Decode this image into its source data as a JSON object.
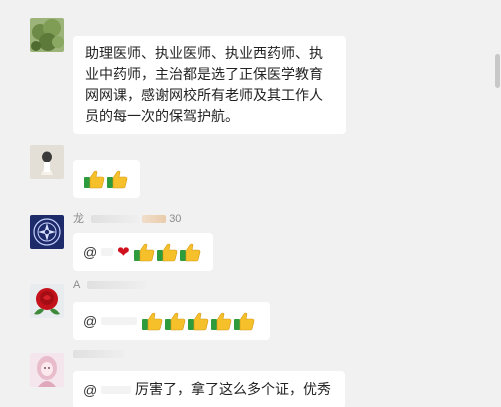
{
  "messages": [
    {
      "sender": "",
      "text": "助理医师、执业医师、执业西药师、执业中药师，主治都是选了正保医学教育网网课，感谢网校所有老师及其工作人员的每一次的保驾护航。",
      "avatar_icon": "green-plant-avatar"
    },
    {
      "sender": "",
      "text": "",
      "thumbs": 2,
      "avatar_icon": "figurine-avatar"
    },
    {
      "sender": "龙",
      "sender_suffix": "30",
      "mention": "@",
      "heart": "❤",
      "thumbs": 3,
      "avatar_icon": "blue-emblem-avatar"
    },
    {
      "sender": "A",
      "mention": "@",
      "thumbs": 5,
      "avatar_icon": "red-rose-avatar"
    },
    {
      "sender": "",
      "mention": "@",
      "text": "厉害了，拿了这么多个证，优秀",
      "avatar_icon": "pink-doll-avatar"
    }
  ],
  "colors": {
    "background": "#f1f1f1",
    "bubble": "#ffffff",
    "thumb_yellow": "#f5c02a",
    "thumb_green": "#2e9b3d"
  }
}
